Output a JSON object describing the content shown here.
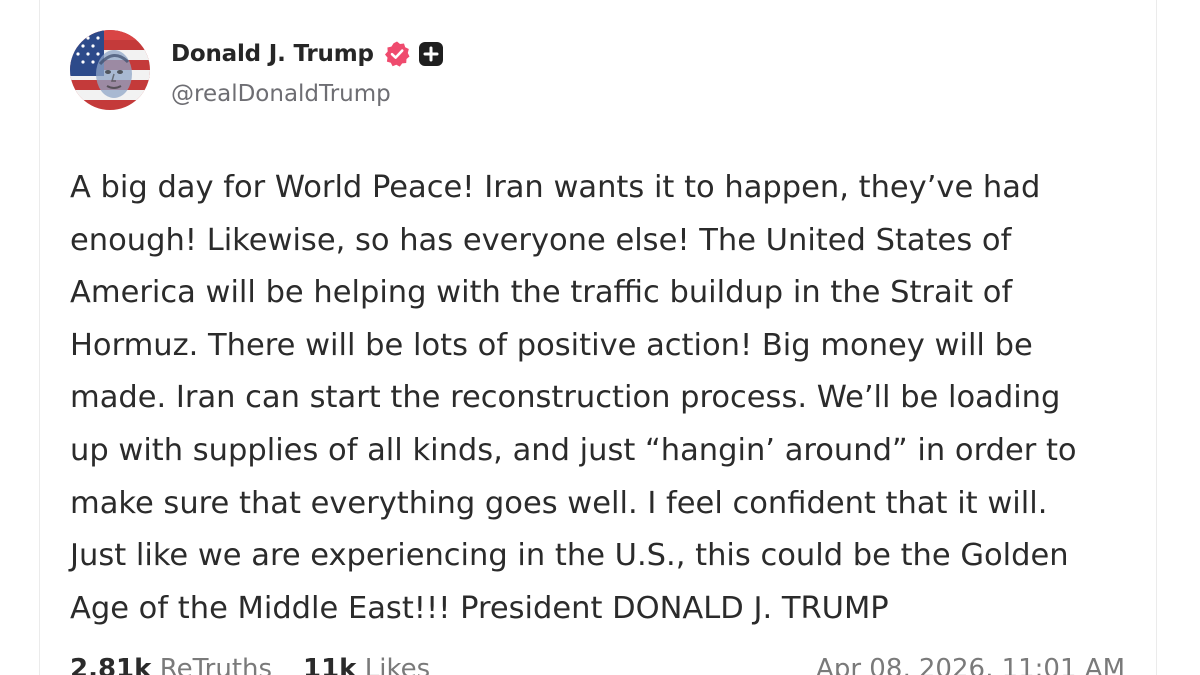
{
  "post": {
    "author": {
      "display_name": "Donald J. Trump",
      "handle": "@realDonaldTrump",
      "verified_icon": "verified-check-icon",
      "verified_color": "#ef4b6e",
      "plus_icon": "plus-square-icon"
    },
    "body_lines": [
      "A big day for World Peace! Iran wants it to happen, they’ve had",
      "enough! Likewise, so has everyone else! The United States of",
      "America will be helping with the traffic buildup in the Strait of",
      "Hormuz. There will be lots of positive action! Big money will be",
      "made. Iran can start the reconstruction process. We’ll be loading",
      "up with supplies of all kinds, and just “hangin’ around” in order to",
      "make sure that everything goes well. I feel confident that it will.",
      "Just like we are experiencing in the U.S., this could be the Golden",
      "Age of the Middle East!!! President DONALD J. TRUMP"
    ],
    "stats": {
      "retruths_count": "2.81k",
      "retruths_label": "ReTruths",
      "likes_count": "11k",
      "likes_label": "Likes"
    },
    "timestamp": "Apr 08, 2026, 11:01 AM"
  }
}
